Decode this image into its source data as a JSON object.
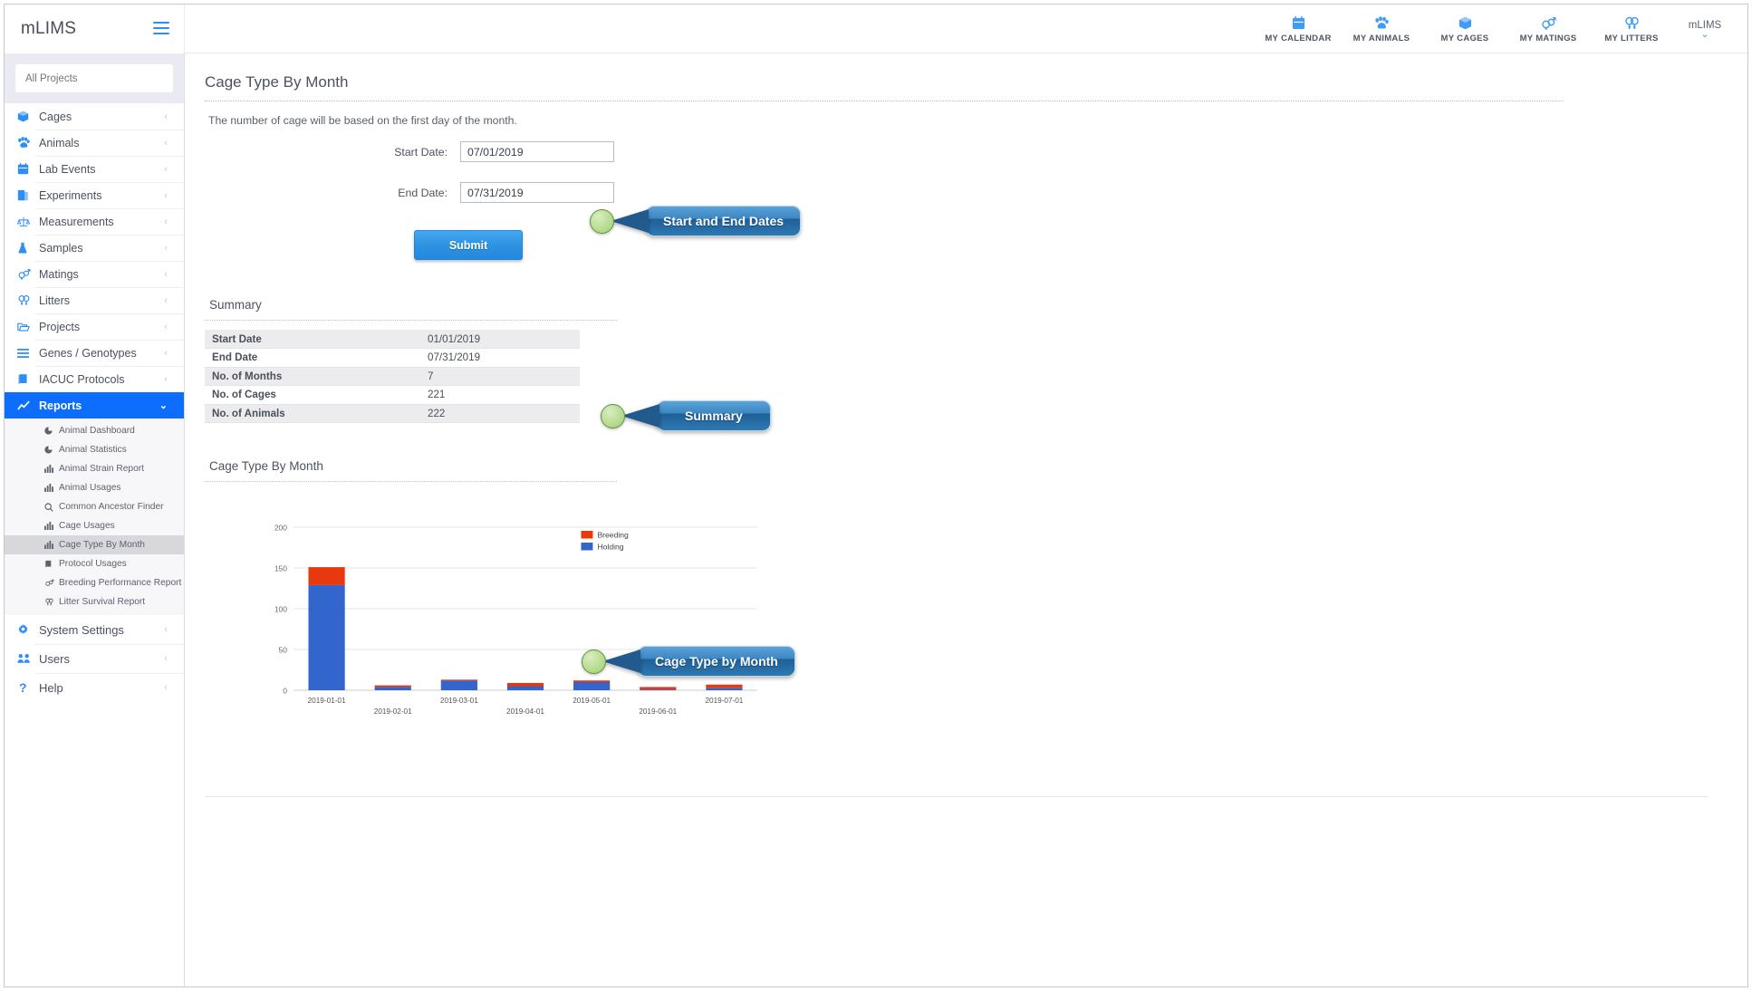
{
  "brand": {
    "name": "mLIMS",
    "menu_icon": "hamburger-icon"
  },
  "topnav": {
    "items": [
      {
        "label": "MY CALENDAR",
        "icon": "calendar-icon"
      },
      {
        "label": "MY ANIMALS",
        "icon": "paw-icon"
      },
      {
        "label": "MY CAGES",
        "icon": "cube-icon"
      },
      {
        "label": "MY MATINGS",
        "icon": "mating-icon"
      },
      {
        "label": "MY LITTERS",
        "icon": "litter-icon"
      }
    ],
    "user": {
      "name": "mLIMS",
      "caret": "chevron-down-icon"
    }
  },
  "sidebar": {
    "project_selector": {
      "placeholder": "All Projects",
      "value": ""
    },
    "items": [
      {
        "label": "Cages",
        "icon": "cube-icon",
        "chevron": "chevron-left-icon",
        "active": false
      },
      {
        "label": "Animals",
        "icon": "paw-icon",
        "chevron": "chevron-left-icon",
        "active": false
      },
      {
        "label": "Lab Events",
        "icon": "calendar-icon",
        "chevron": "chevron-left-icon",
        "active": false
      },
      {
        "label": "Experiments",
        "icon": "flask-doc-icon",
        "chevron": "chevron-left-icon",
        "active": false
      },
      {
        "label": "Measurements",
        "icon": "scale-icon",
        "chevron": "chevron-left-icon",
        "active": false
      },
      {
        "label": "Samples",
        "icon": "sample-icon",
        "chevron": "chevron-left-icon",
        "active": false
      },
      {
        "label": "Matings",
        "icon": "mating-icon",
        "chevron": "chevron-left-icon",
        "active": false
      },
      {
        "label": "Litters",
        "icon": "litter-icon",
        "chevron": "chevron-left-icon",
        "active": false
      },
      {
        "label": "Projects",
        "icon": "folder-icon",
        "chevron": "chevron-left-icon",
        "active": false
      },
      {
        "label": "Genes / Genotypes",
        "icon": "list-icon",
        "chevron": "chevron-left-icon",
        "active": false
      },
      {
        "label": "IACUC Protocols",
        "icon": "book-icon",
        "chevron": "chevron-left-icon",
        "active": false
      },
      {
        "label": "Reports",
        "icon": "chart-line-icon",
        "chevron": "chevron-down-icon",
        "active": true
      }
    ],
    "reports_subitems": [
      {
        "label": "Animal Dashboard",
        "icon": "pie-chart-icon",
        "active": false
      },
      {
        "label": "Animal Statistics",
        "icon": "pie-chart-icon",
        "active": false
      },
      {
        "label": "Animal Strain Report",
        "icon": "bar-chart-icon",
        "active": false
      },
      {
        "label": "Animal Usages",
        "icon": "bar-chart-icon",
        "active": false
      },
      {
        "label": "Common Ancestor Finder",
        "icon": "search-icon",
        "active": false
      },
      {
        "label": "Cage Usages",
        "icon": "bar-chart-icon",
        "active": false
      },
      {
        "label": "Cage Type By Month",
        "icon": "bar-chart-icon",
        "active": true
      },
      {
        "label": "Protocol Usages",
        "icon": "book-icon",
        "active": false
      },
      {
        "label": "Breeding Performance Report",
        "icon": "mating-icon",
        "active": false
      },
      {
        "label": "Litter Survival Report",
        "icon": "litter-icon",
        "active": false
      }
    ],
    "footer_items": [
      {
        "label": "System Settings",
        "icon": "gear-icon",
        "chevron": "chevron-left-icon"
      },
      {
        "label": "Users",
        "icon": "users-icon",
        "chevron": "chevron-left-icon"
      },
      {
        "label": "Help",
        "icon": "question-icon",
        "chevron": "chevron-left-icon"
      }
    ]
  },
  "page": {
    "title": "Cage Type By Month",
    "description": "The number of cage will be based on the first day of the month.",
    "form": {
      "start_date_label": "Start Date:",
      "start_date_value": "07/01/2019",
      "end_date_label": "End Date:",
      "end_date_value": "07/31/2019",
      "submit_label": "Submit"
    },
    "summary": {
      "heading": "Summary",
      "rows": [
        {
          "key": "Start Date",
          "value": "01/01/2019",
          "link": false
        },
        {
          "key": "End Date",
          "value": "07/31/2019",
          "link": false
        },
        {
          "key": "No. of Months",
          "value": "7",
          "link": false
        },
        {
          "key": "No. of Cages",
          "value": "221",
          "link": true
        },
        {
          "key": "No. of Animals",
          "value": "222",
          "link": true
        }
      ]
    },
    "chart_section_heading": "Cage Type By Month"
  },
  "callouts": [
    {
      "label": "Start and End Dates"
    },
    {
      "label": "Summary"
    },
    {
      "label": "Cage Type by Month"
    }
  ],
  "colors": {
    "breeding": "#e8380d",
    "holding": "#3366cc",
    "accent": "#0d6efd",
    "link": "#2f7fd4"
  },
  "chart_data": {
    "type": "bar",
    "stacked": true,
    "title": "Cage Type By Month",
    "xlabel": "",
    "ylabel": "",
    "ylim": [
      0,
      200
    ],
    "yticks": [
      0,
      50,
      100,
      150,
      200
    ],
    "grid": true,
    "legend_position": "top-right",
    "categories": [
      "2019-01-01",
      "2019-02-01",
      "2019-03-01",
      "2019-04-01",
      "2019-05-01",
      "2019-06-01",
      "2019-07-01"
    ],
    "series": [
      {
        "name": "Holding",
        "color": "#3366cc",
        "values": [
          129,
          4,
          12,
          5,
          10,
          1,
          3
        ]
      },
      {
        "name": "Breeding",
        "color": "#e8380d",
        "values": [
          22,
          2,
          1,
          4,
          2,
          3,
          4
        ]
      }
    ]
  }
}
